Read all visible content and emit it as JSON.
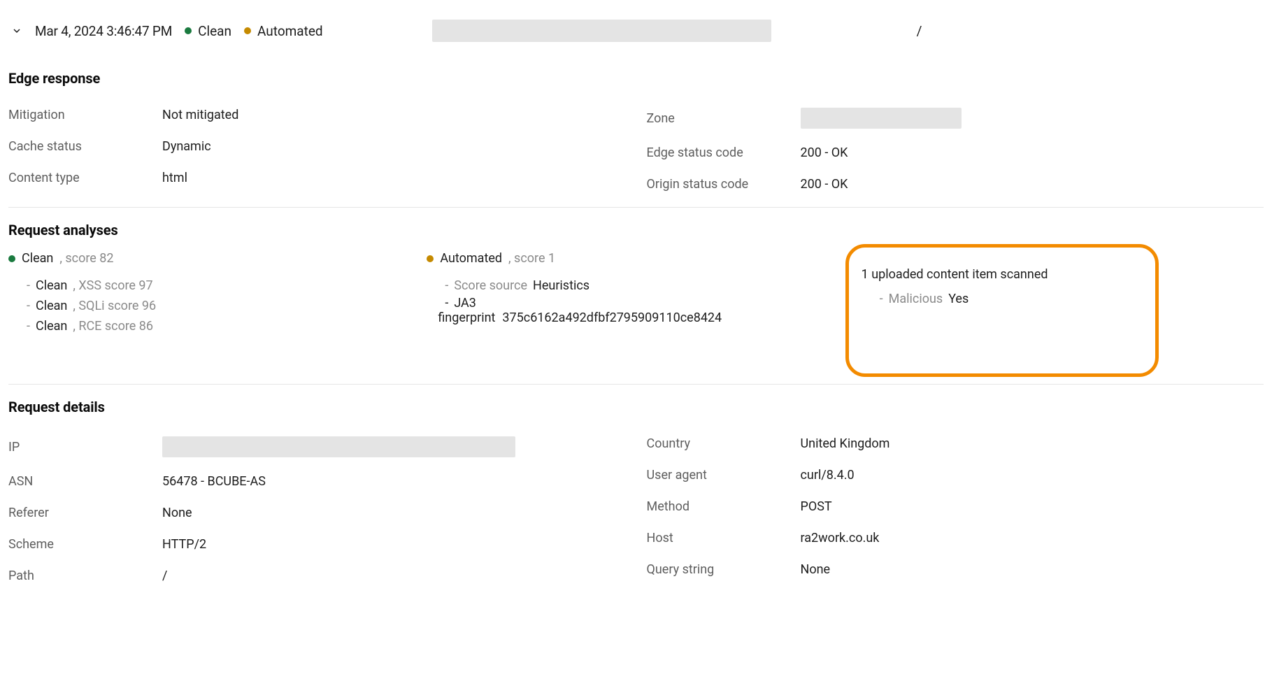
{
  "header": {
    "timestamp": "Mar 4, 2024 3:46:47 PM",
    "status1": "Clean",
    "status2": "Automated",
    "path": "/"
  },
  "edge_response": {
    "title": "Edge response",
    "mitigation": {
      "label": "Mitigation",
      "value": "Not mitigated"
    },
    "cache_status": {
      "label": "Cache status",
      "value": "Dynamic"
    },
    "content_type": {
      "label": "Content type",
      "value": "html"
    },
    "zone": {
      "label": "Zone",
      "value": ""
    },
    "edge_status_code": {
      "label": "Edge status code",
      "value": "200 - OK"
    },
    "origin_status_code": {
      "label": "Origin status code",
      "value": "200 - OK"
    }
  },
  "analyses": {
    "title": "Request analyses",
    "waf": {
      "label": "Clean",
      "score_text": ", score 82",
      "items": [
        {
          "status": "Clean",
          "name": ", XSS score 97"
        },
        {
          "status": "Clean",
          "name": ", SQLi score 96"
        },
        {
          "status": "Clean",
          "name": ", RCE score 86"
        }
      ]
    },
    "bot": {
      "label": "Automated",
      "score_text": ", score 1",
      "source_label": "Score source",
      "source_value": "Heuristics",
      "ja3_label": "JA3",
      "fingerprint_label": "fingerprint",
      "fingerprint_value": "375c6162a492dfbf2795909110ce8424"
    },
    "scan": {
      "head": "1 uploaded content item scanned",
      "malicious_label": "Malicious",
      "malicious_value": "Yes"
    }
  },
  "details": {
    "title": "Request details",
    "ip": {
      "label": "IP",
      "value": ""
    },
    "asn": {
      "label": "ASN",
      "value": "56478 - BCUBE-AS"
    },
    "referer": {
      "label": "Referer",
      "value": "None"
    },
    "scheme": {
      "label": "Scheme",
      "value": "HTTP/2"
    },
    "path": {
      "label": "Path",
      "value": "/"
    },
    "country": {
      "label": "Country",
      "value": "United Kingdom"
    },
    "ua": {
      "label": "User agent",
      "value": "curl/8.4.0"
    },
    "method": {
      "label": "Method",
      "value": "POST"
    },
    "host": {
      "label": "Host",
      "value": "ra2work.co.uk"
    },
    "qs": {
      "label": "Query string",
      "value": "None"
    }
  }
}
